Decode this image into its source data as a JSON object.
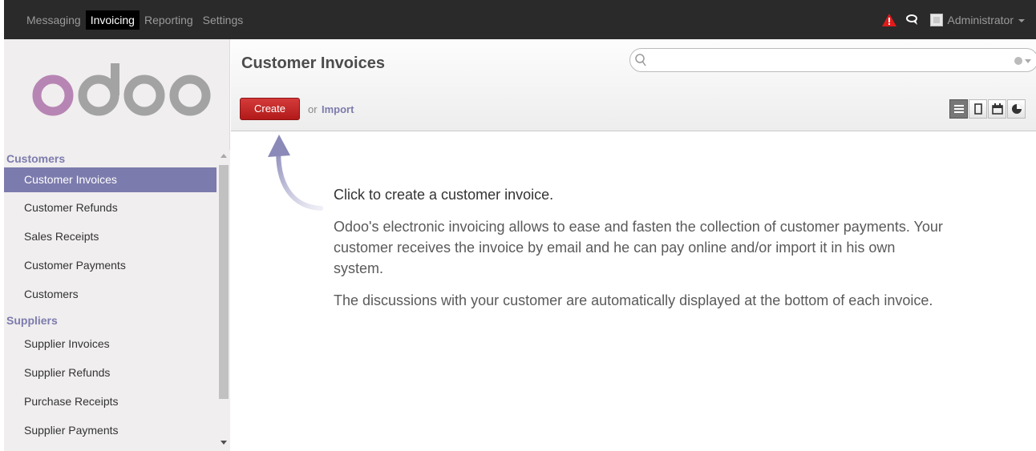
{
  "topbar": {
    "menus": [
      {
        "label": "Messaging",
        "active": false
      },
      {
        "label": "Invoicing",
        "active": true
      },
      {
        "label": "Reporting",
        "active": false
      },
      {
        "label": "Settings",
        "active": false
      }
    ],
    "user_name": "Administrator",
    "alert_icon": "warning-icon",
    "chat_icon": "chat-icon",
    "alert_color": "#e01b1b"
  },
  "sidebar": {
    "logo_text": "odoo",
    "sections": [
      {
        "header": "Customers",
        "items": [
          "Customer Invoices",
          "Customer Refunds",
          "Sales Receipts",
          "Customer Payments",
          "Customers"
        ]
      },
      {
        "header": "Suppliers",
        "items": [
          "Supplier Invoices",
          "Supplier Refunds",
          "Purchase Receipts",
          "Supplier Payments"
        ]
      }
    ],
    "active_item": "Customer Invoices",
    "accent_color": "#7c7bad"
  },
  "control_panel": {
    "title": "Customer Invoices",
    "search_placeholder": "",
    "create_label": "Create",
    "or_label": "or",
    "import_label": "Import",
    "views": [
      "list-view-icon",
      "form-view-icon",
      "calendar-view-icon",
      "graph-view-icon"
    ]
  },
  "help": {
    "lead": "Click to create a customer invoice.",
    "para1": "Odoo's electronic invoicing allows to ease and fasten the collection of customer payments. Your customer receives the invoice by email and he can pay online and/or import it in his own system.",
    "para2": "The discussions with your customer are automatically displayed at the bottom of each invoice."
  }
}
